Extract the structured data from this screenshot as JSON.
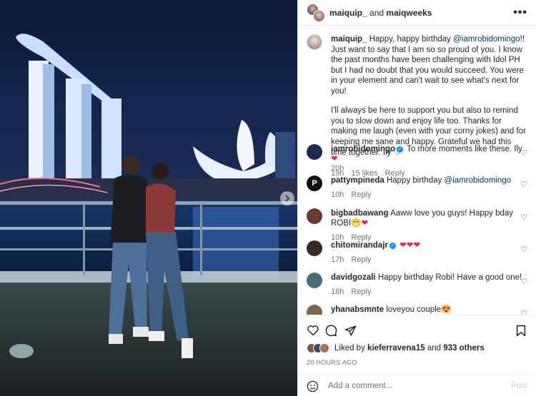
{
  "post_header": {
    "user1": "maiquip_",
    "joiner": "and",
    "user2": "maiqweeks",
    "more_label": "•••"
  },
  "caption": {
    "username": "maiquip_",
    "text_before_mention": "Happy, happy birthday",
    "mention": "@iamrobidomingo",
    "text_after_mention": "!! Just want to say that I am so so proud of you. I know the past months have been challenging with Idol PH but I had no doubt that you would succeed. You were in your element and can't wait to see what's next for you!",
    "paragraph2": "I'll always be here to support you but also to remind you to slow down and enjoy life too. Thanks for making me laugh (even with your corny jokes) and for keeping me sane and happy. Grateful we had this time together. Ily",
    "heart_glyph": "♡",
    "time": "20h"
  },
  "comments": [
    {
      "username": "iamrobidomingo",
      "verified": true,
      "text": "To more moments like these. Ily",
      "emoji": "❤",
      "time": "19h",
      "likes": "15 likes",
      "reply": "Reply",
      "avatar_color": "#1d2b4c"
    },
    {
      "username": "pattympineda",
      "verified": false,
      "text": "Happy birthday",
      "mention": "@iamrobidomingo",
      "time": "10h",
      "reply": "Reply",
      "avatar_color": "#111111"
    },
    {
      "username": "bigbadbawang",
      "verified": false,
      "text": "Aaww love you guys! Happy bday ROBI",
      "emoji": "😁❤",
      "time": "10h",
      "reply": "Reply",
      "avatar_color": "#6b3a2e"
    },
    {
      "username": "chitomirandajr",
      "verified": true,
      "text": "",
      "emoji": "❤❤❤",
      "time": "17h",
      "reply": "Reply",
      "avatar_color": "#3a2b22"
    },
    {
      "username": "davidgozali",
      "verified": false,
      "text": "Happy birthday Robi! Have a good one!",
      "time": "18h",
      "reply": "Reply",
      "avatar_color": "#4c6b7a"
    },
    {
      "username": "yhanabsmnte",
      "verified": false,
      "text": "loveyou couple",
      "emoji": "😍",
      "avatar_color": "#7a6a4c"
    }
  ],
  "likes": {
    "prefix": "Liked by",
    "user": "kieferravena15",
    "joiner": "and",
    "others": "933 others"
  },
  "timestamp": "20 HOURS AGO",
  "add_comment": {
    "placeholder": "Add a comment...",
    "post_label": "Post"
  },
  "colors": {
    "link": "#00376b",
    "post_button": "#b2dffc",
    "heart": "#e0245e",
    "verified": "#0095f6"
  }
}
